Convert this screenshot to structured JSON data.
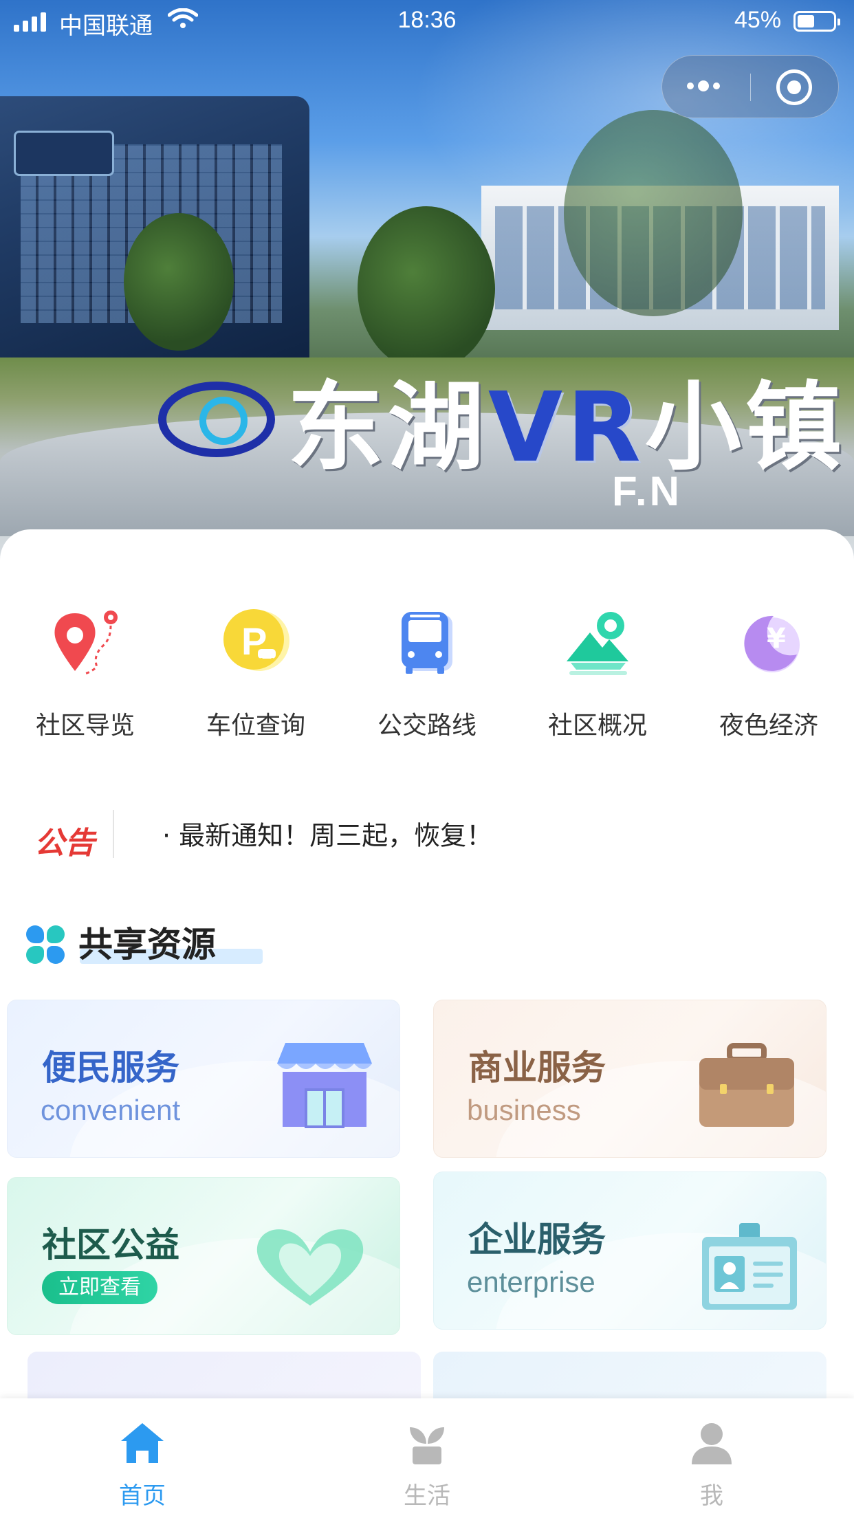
{
  "status_bar": {
    "carrier": "中国联通",
    "time": "18:36",
    "battery": "45%"
  },
  "hero": {
    "title_prefix": "东湖",
    "title_vr": "VR",
    "title_suffix": "小镇",
    "watermark": "F.N"
  },
  "quick_nav": [
    {
      "label": "社区导览",
      "icon": "map-pin-route-icon"
    },
    {
      "label": "车位查询",
      "icon": "parking-icon"
    },
    {
      "label": "公交路线",
      "icon": "bus-icon"
    },
    {
      "label": "社区概况",
      "icon": "landscape-icon"
    },
    {
      "label": "夜色经济",
      "icon": "moon-yen-icon"
    }
  ],
  "notice": {
    "tag": "公告",
    "text": "· 最新通知！周三起，恢复！"
  },
  "section": {
    "title": "共享资源"
  },
  "services": {
    "convenient": {
      "title": "便民服务",
      "subtitle": "convenient"
    },
    "business": {
      "title": "商业服务",
      "subtitle": "business"
    },
    "charity": {
      "title": "社区公益",
      "button": "立即查看"
    },
    "enterprise": {
      "title": "企业服务",
      "subtitle": "enterprise"
    }
  },
  "peek": {
    "left": "",
    "right": ""
  },
  "tab_bar": {
    "home": "首页",
    "life": "生活",
    "me": "我",
    "active_color": "#2c9af0",
    "inactive_color": "#b8b8b8"
  },
  "colors": {
    "notice_red": "#e53935",
    "section_accent_blue": "#2c9af0",
    "section_accent_teal": "#28c7c0"
  }
}
